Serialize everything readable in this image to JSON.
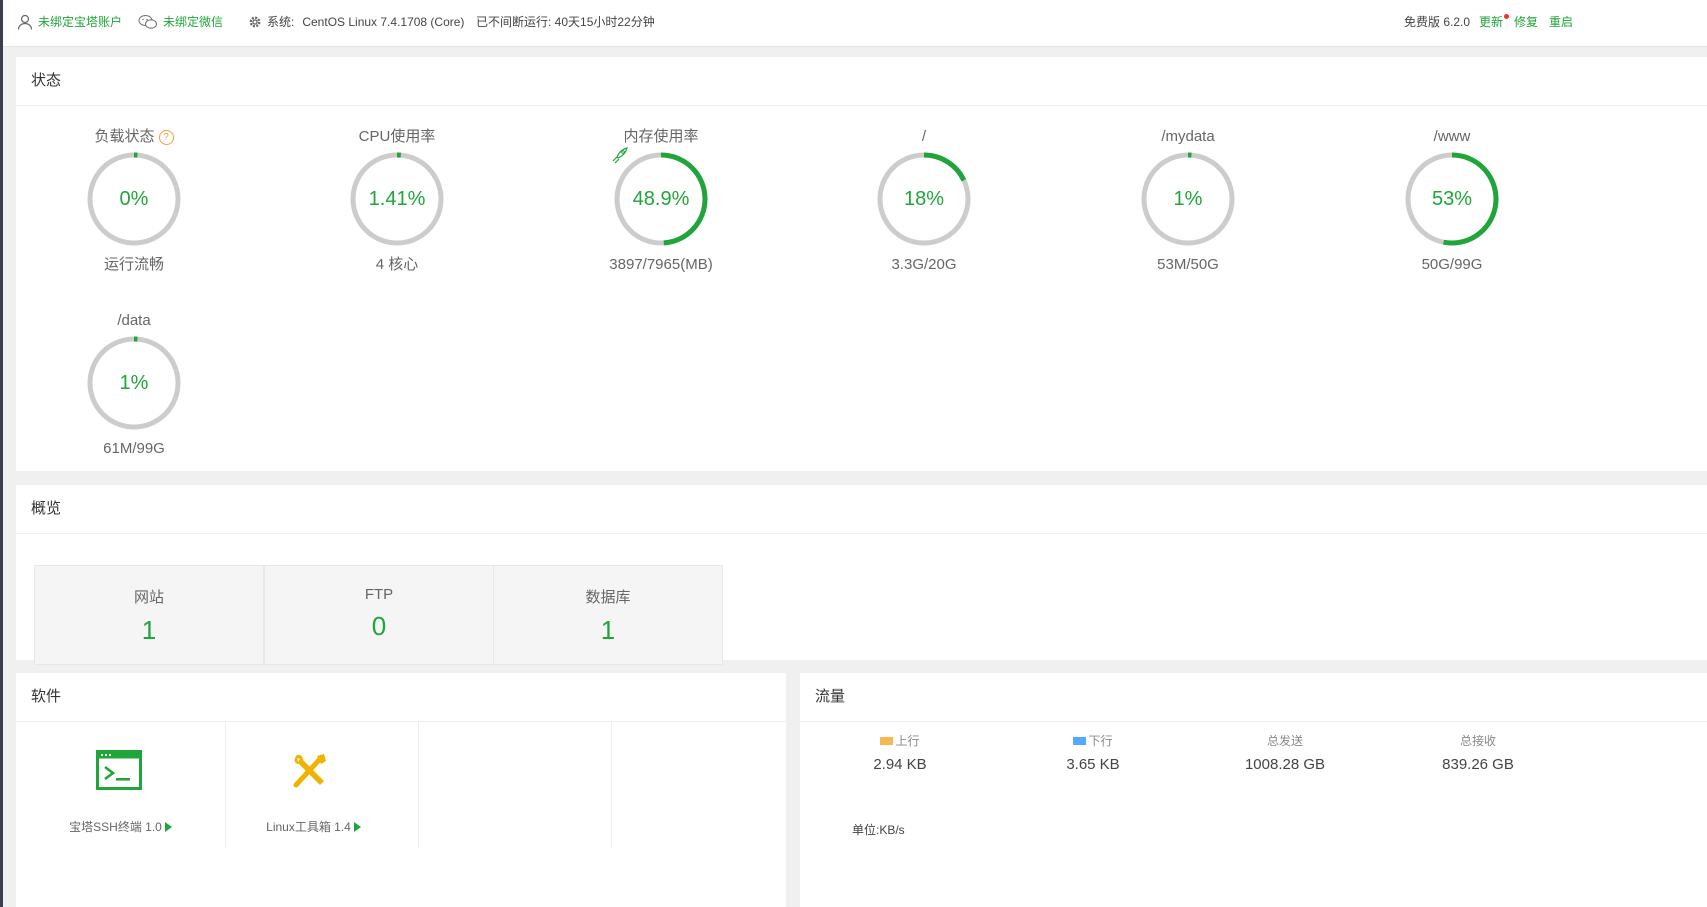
{
  "topbar": {
    "bind_account": "未绑定宝塔账户",
    "bind_wechat": "未绑定微信",
    "system_label": "系统:",
    "system_value": "CentOS Linux 7.4.1708 (Core)",
    "uptime": "已不间断运行: 40天15小时22分钟",
    "version": "免费版 6.2.0",
    "update": "更新",
    "repair": "修复",
    "restart": "重启"
  },
  "status": {
    "title": "状态",
    "gauges": [
      {
        "title": "负载状态",
        "value": "0%",
        "percent": 0,
        "sub": "运行流畅",
        "help": "?"
      },
      {
        "title": "CPU使用率",
        "value": "1.41%",
        "percent": 1.41,
        "sub": "4 核心"
      },
      {
        "title": "内存使用率",
        "value": "48.9%",
        "percent": 48.9,
        "sub": "3897/7965(MB)"
      },
      {
        "title": "/",
        "value": "18%",
        "percent": 18,
        "sub": "3.3G/20G"
      },
      {
        "title": "/mydata",
        "value": "1%",
        "percent": 1,
        "sub": "53M/50G"
      },
      {
        "title": "/www",
        "value": "53%",
        "percent": 53,
        "sub": "50G/99G"
      },
      {
        "title": "/data",
        "value": "1%",
        "percent": 1,
        "sub": "61M/99G"
      }
    ]
  },
  "overview": {
    "title": "概览",
    "cards": [
      {
        "label": "网站",
        "value": "1"
      },
      {
        "label": "FTP",
        "value": "0"
      },
      {
        "label": "数据库",
        "value": "1"
      }
    ]
  },
  "software": {
    "title": "软件",
    "items": [
      {
        "label": "宝塔SSH终端 1.0"
      },
      {
        "label": "Linux工具箱 1.4"
      }
    ]
  },
  "traffic": {
    "title": "流量",
    "up_label": "上行",
    "up_value": "2.94 KB",
    "down_label": "下行",
    "down_value": "3.65 KB",
    "sent_label": "总发送",
    "sent_value": "1008.28 GB",
    "recv_label": "总接收",
    "recv_value": "839.26 GB",
    "unit": "单位:KB/s"
  },
  "colors": {
    "accent": "#20a53a",
    "ring_track": "#cccccc",
    "up_swatch": "#f7b851",
    "down_swatch": "#52a9ff"
  }
}
